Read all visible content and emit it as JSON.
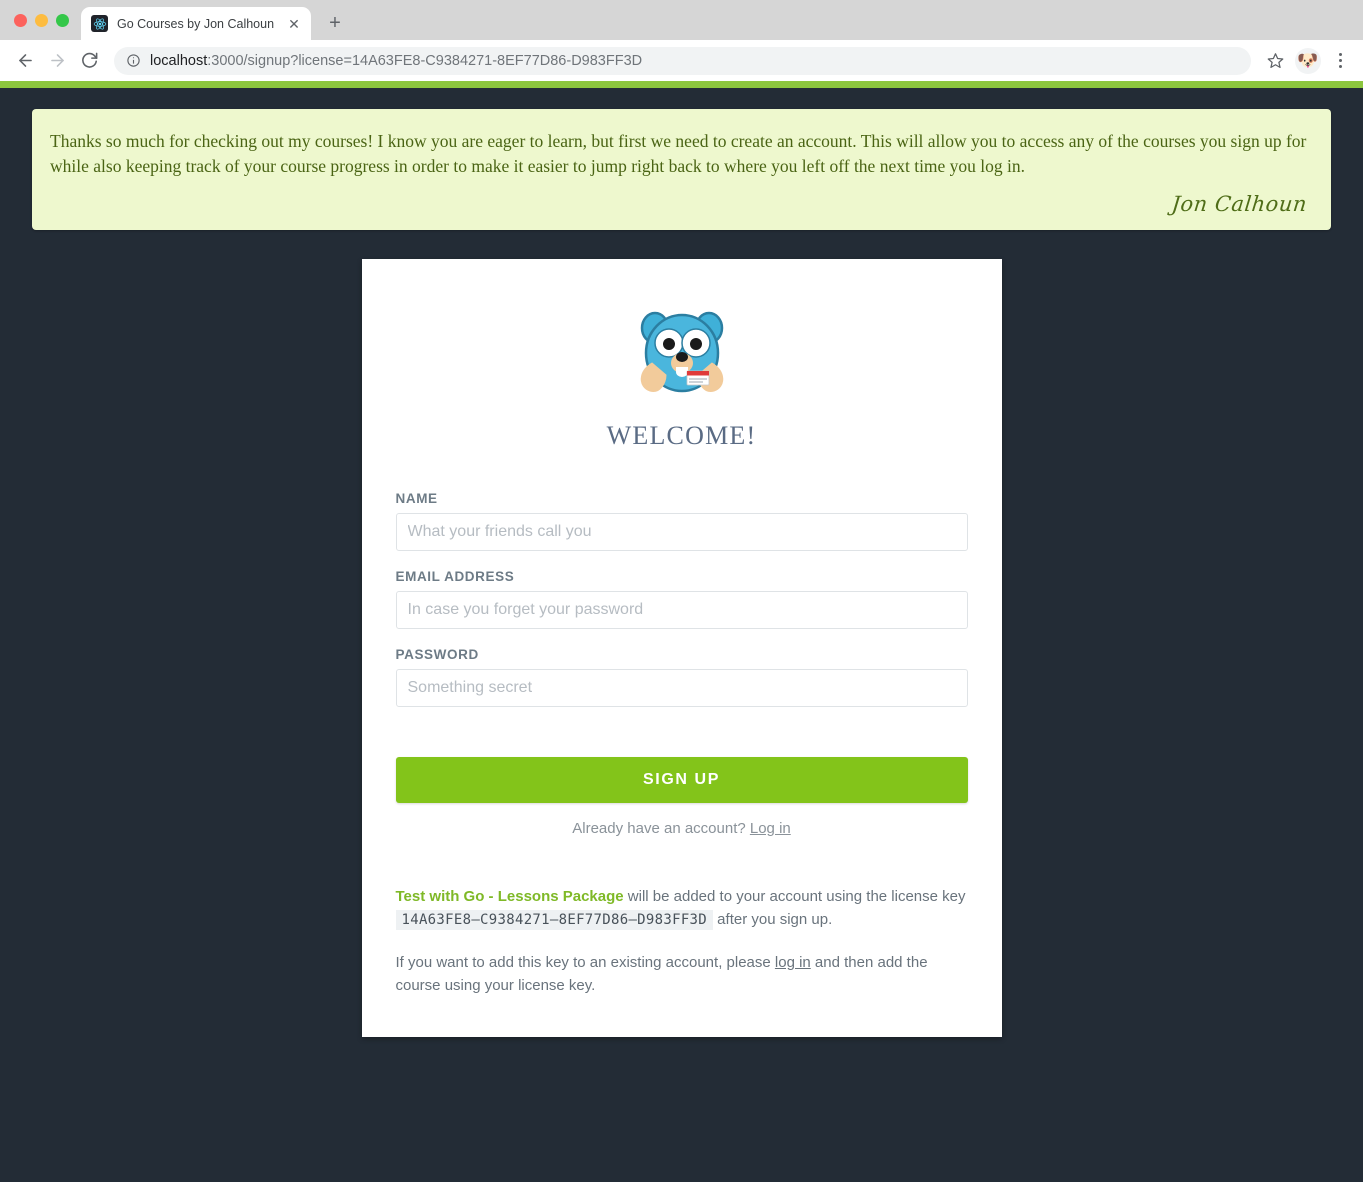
{
  "browser": {
    "tab": {
      "title": "Go Courses by Jon Calhoun",
      "favicon_name": "react-atom-icon",
      "close_label": "✕"
    },
    "new_tab_label": "+",
    "nav": {
      "back_label": "←",
      "forward_label": "→",
      "reload_label": "⟳"
    },
    "omnibox": {
      "info_icon": "page-info-icon",
      "host": "localhost",
      "path": ":3000/signup?license=14A63FE8-C9384271-8EF77D86-D983FF3D",
      "full_url": "localhost:3000/signup?license=14A63FE8-C9384271-8EF77D86-D983FF3D"
    },
    "star_label": "☆",
    "avatar_label": "🐶",
    "menu_label": "kebab-menu"
  },
  "page": {
    "accent_color": "#8cc63e",
    "background_color": "#232c36",
    "banner": {
      "message": "Thanks so much for checking out my courses! I know you are eager to learn, but first we need to create an account. This will allow you to access any of the courses you sign up for while also keeping track of your course progress in order to make it easier to jump right back to where you left off the next time you log in.",
      "signature": "Jon Calhoun",
      "background_color": "#eef8ce",
      "text_color": "#4a6414"
    },
    "card": {
      "logo_name": "go-gopher-logo",
      "heading": "WELCOME!",
      "fields": [
        {
          "name": "name",
          "label": "NAME",
          "placeholder": "What your friends call you",
          "value": "",
          "type": "text"
        },
        {
          "name": "email",
          "label": "EMAIL ADDRESS",
          "placeholder": "In case you forget your password",
          "value": "",
          "type": "text"
        },
        {
          "name": "password",
          "label": "PASSWORD",
          "placeholder": "Something secret",
          "value": "",
          "type": "password"
        }
      ],
      "submit_label": "SIGN UP",
      "submit_color": "#83c41a",
      "already_prefix": "Already have an account? ",
      "already_link": "Log in",
      "license": {
        "package_name": "Test with Go - Lessons Package",
        "package_color": "#7fb927",
        "sentence_mid": " will be added to your account using the license key ",
        "key": "14A63FE8–C9384271–8EF77D86–D983FF3D",
        "sentence_end": " after you sign up.",
        "alt_prefix": "If you want to add this key to an existing account, please ",
        "alt_link": "log in",
        "alt_suffix": " and then add the course using your license key."
      }
    }
  }
}
